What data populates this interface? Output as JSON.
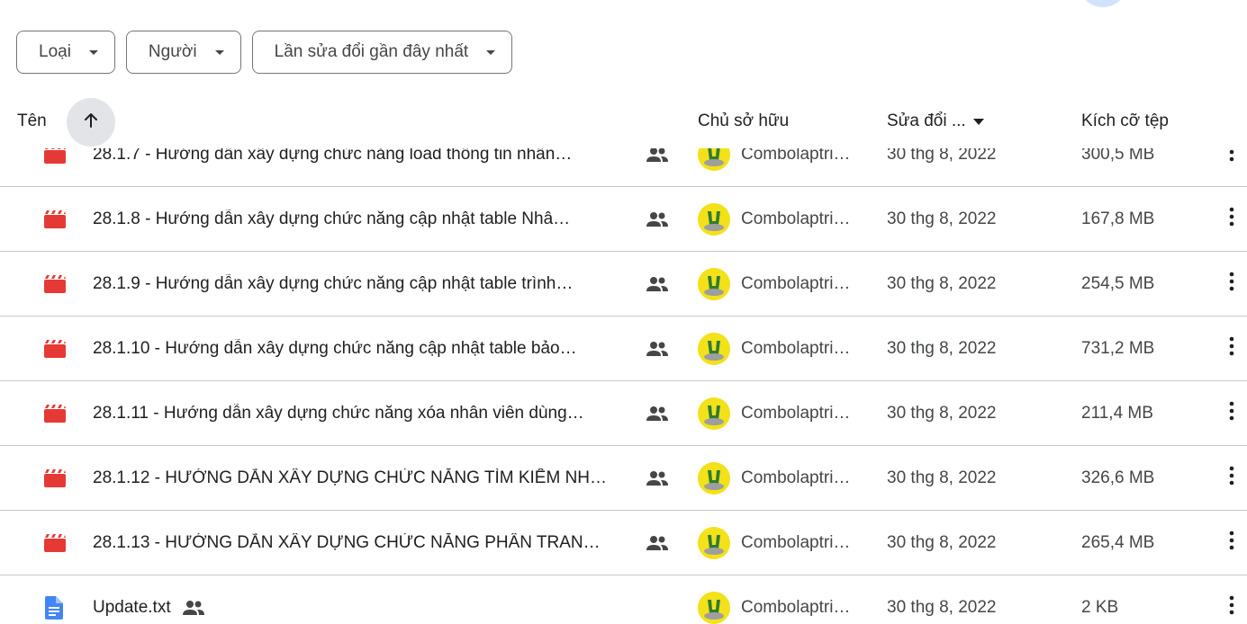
{
  "filters": [
    {
      "label": "Loại"
    },
    {
      "label": "Người"
    },
    {
      "label": "Lần sửa đổi gần đây nhất"
    }
  ],
  "header": {
    "name": "Tên",
    "owner": "Chủ sở hữu",
    "modified": "Sửa đổi ...",
    "size": "Kích cỡ tệp"
  },
  "colors": {
    "video_icon": "#e53935",
    "doc_icon": "#4285f4",
    "owner_avatar_bg": "#f3e11a"
  },
  "rows": [
    {
      "type": "video",
      "name": "28.1.7 - Hướng dẫn xây dựng chức năng load thông tin nhân…",
      "owner": "Combolaptri…",
      "modified": "30 thg 8, 2022",
      "size": "300,5 MB"
    },
    {
      "type": "video",
      "name": "28.1.8 - Hướng dẫn xây dựng chức năng cập nhật table Nhâ…",
      "owner": "Combolaptri…",
      "modified": "30 thg 8, 2022",
      "size": "167,8 MB"
    },
    {
      "type": "video",
      "name": "28.1.9 - Hướng dẫn xây dựng chức năng cập nhật table trình…",
      "owner": "Combolaptri…",
      "modified": "30 thg 8, 2022",
      "size": "254,5 MB"
    },
    {
      "type": "video",
      "name": "28.1.10 - Hướng dẫn xây dựng chức năng cập nhật table bảo…",
      "owner": "Combolaptri…",
      "modified": "30 thg 8, 2022",
      "size": "731,2 MB"
    },
    {
      "type": "video",
      "name": "28.1.11 - Hướng dẫn xây dựng chức năng xóa nhân viên dùng…",
      "owner": "Combolaptri…",
      "modified": "30 thg 8, 2022",
      "size": "211,4 MB"
    },
    {
      "type": "video",
      "name": "28.1.12 - HƯỚNG DẪN XÂY DỰNG CHỨC NĂNG TÌM KIẾM NH…",
      "owner": "Combolaptri…",
      "modified": "30 thg 8, 2022",
      "size": "326,6 MB"
    },
    {
      "type": "video",
      "name": "28.1.13 -  HƯỚNG DẪN XÂY DỰNG CHỨC NĂNG PHÂN TRAN…",
      "owner": "Combolaptri…",
      "modified": "30 thg 8, 2022",
      "size": "265,4 MB"
    },
    {
      "type": "doc",
      "name": "Update.txt",
      "owner": "Combolaptri…",
      "modified": "30 thg 8, 2022",
      "size": "2 KB"
    }
  ]
}
